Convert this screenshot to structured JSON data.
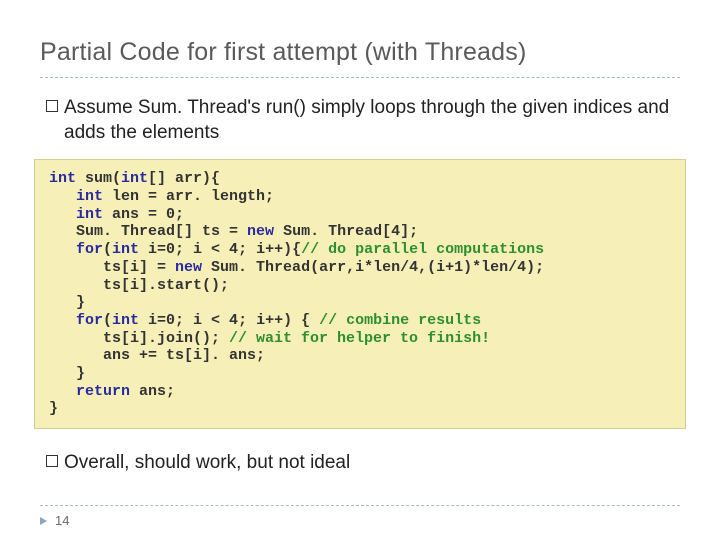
{
  "title": "Partial Code for first attempt (with Threads)",
  "bullet1": "Assume Sum. Thread's run() simply loops through the given indices and adds the elements",
  "bullet2": "Overall, should work, but not ideal",
  "code": {
    "l1a": "int",
    "l1b": " sum(",
    "l1c": "int",
    "l1d": "[] arr){",
    "l2a": "   int",
    "l2b": " len = arr. length;",
    "l3a": "   int",
    "l3b": " ans = 0;",
    "l4a": "   Sum. Thread[] ts = ",
    "l4b": "new",
    "l4c": " Sum. Thread[4];",
    "l5a": "   for",
    "l5b": "(",
    "l5c": "int",
    "l5d": " i=0; i < 4; i++){",
    "l5e": "// do parallel computations",
    "l6a": "      ts[i] = ",
    "l6b": "new",
    "l6c": " Sum. Thread(arr,i*len/4,(i+1)*len/4);",
    "l7": "      ts[i].start();",
    "l8": "   }",
    "l9a": "   for",
    "l9b": "(",
    "l9c": "int",
    "l9d": " i=0; i < 4; i++) { ",
    "l9e": "// combine results",
    "l10a": "      ts[i].join(); ",
    "l10b": "// wait for helper to finish!",
    "l11": "      ans += ts[i]. ans;",
    "l12": "   }",
    "l13a": "   return",
    "l13b": " ans;",
    "l14": "}"
  },
  "pagenum": "14"
}
